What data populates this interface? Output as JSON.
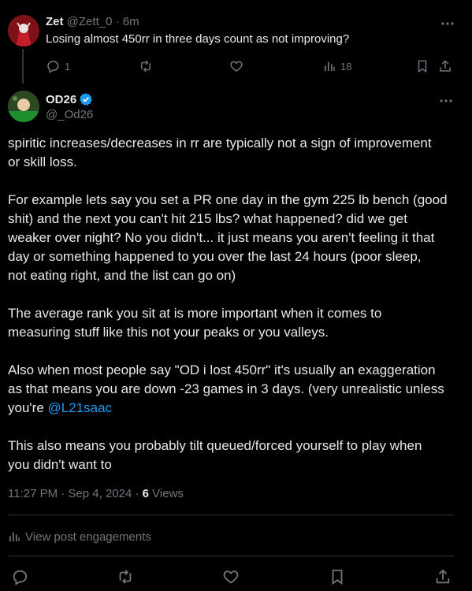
{
  "reply": {
    "name": "Zet",
    "handle": "@Zett_0",
    "separator": " · ",
    "time": "6m",
    "text": "Losing almost 450rr in three days count as not improving?",
    "reply_count": "1",
    "view_count": "18"
  },
  "post": {
    "name": "OD26",
    "handle": "@_Od26",
    "paragraphs": [
      "spiritic increases/decreases in rr are typically not a sign of improvement\nor skill loss.",
      "For example lets say you set a PR one day in the gym 225 lb bench (good\nshit) and the next you can't hit 215 lbs? what happened? did we get\nweaker over night? No you didn't... it just means you aren't feeling it that\nday or something happened to you over the last 24 hours (poor sleep,\nnot eating right, and the list can go on)",
      "The average rank you sit at is more important when it comes to\nmeasuring stuff like this not your peaks or you valleys."
    ],
    "para4_text": "Also when most people say \"OD i lost 450rr\" it's usually an exaggeration\nas that means you are down -23 games in 3 days. (very unrealistic unless\nyou're ",
    "mention": "@L21saac",
    "para5": "This also means you probably tilt queued/forced yourself to play when\nyou didn't want to",
    "timestamp": "11:27 PM · Sep 4, 2024",
    "meta_sep": " · ",
    "views_count": "6",
    "views_label": " Views",
    "engagements_label": "View post engagements"
  },
  "colors": {
    "background": "#000000",
    "text": "#e7e9ea",
    "muted": "#71767b",
    "link": "#1d9bf0",
    "divider": "#2f3336"
  },
  "icons": {
    "reply": "reply-icon",
    "repost": "repost-icon",
    "like": "like-icon",
    "views": "views-icon",
    "bookmark": "bookmark-icon",
    "share": "share-icon",
    "more": "more-icon",
    "verified": "verified-icon"
  }
}
